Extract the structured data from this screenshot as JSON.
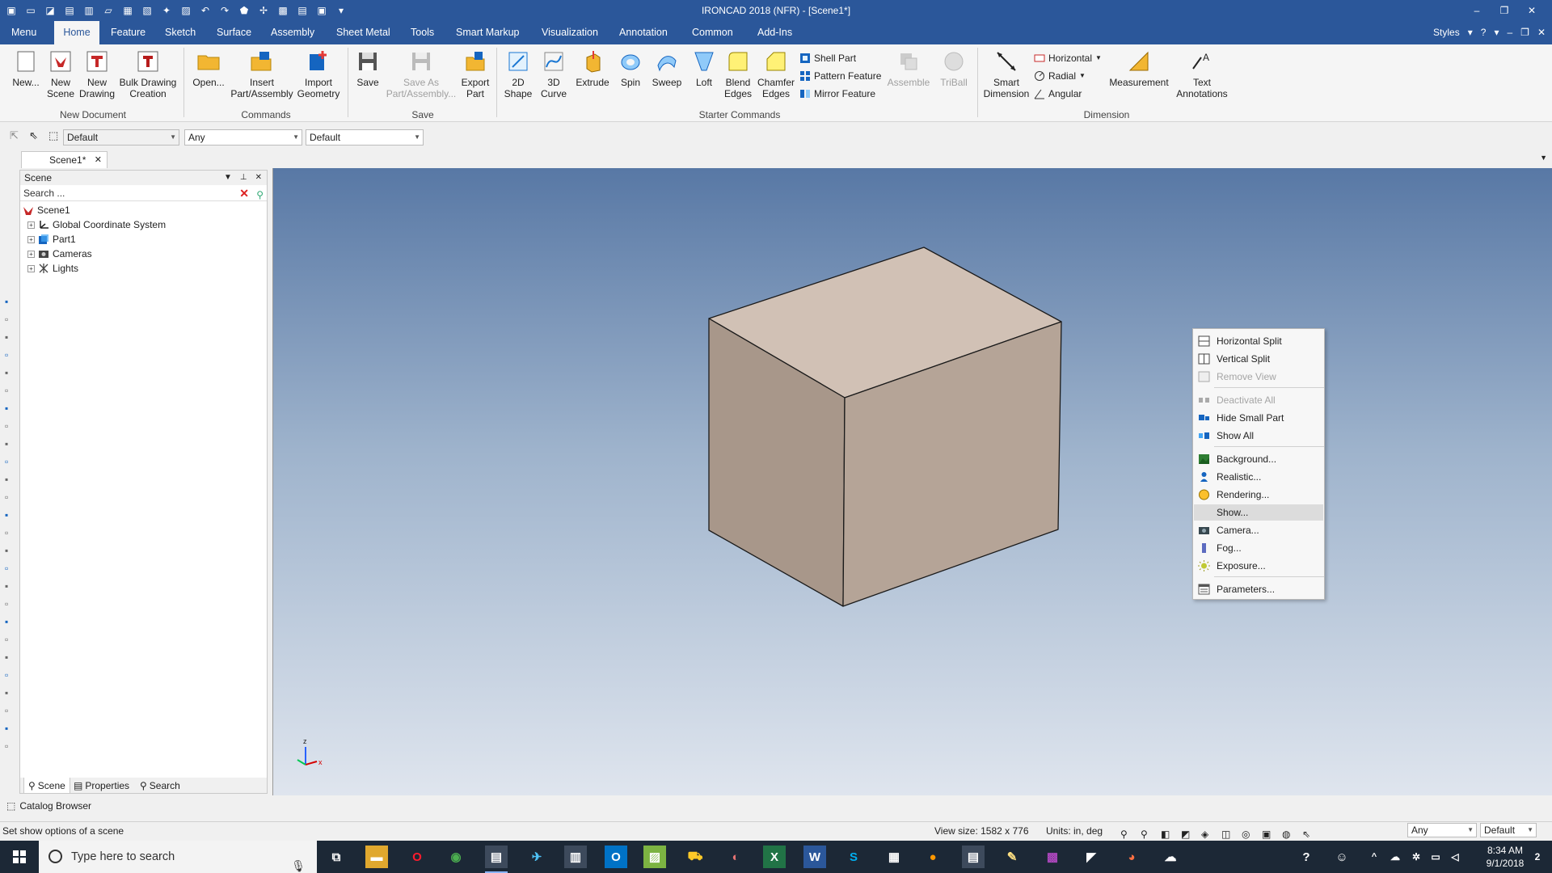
{
  "window": {
    "title": "IRONCAD 2018 (NFR) - [Scene1*]",
    "controls": [
      "–",
      "❐",
      "✕"
    ]
  },
  "ribbon_tabs": [
    {
      "label": "Menu"
    },
    {
      "label": "Home"
    },
    {
      "label": "Feature"
    },
    {
      "label": "Sketch"
    },
    {
      "label": "Surface"
    },
    {
      "label": "Assembly"
    },
    {
      "label": "Sheet Metal"
    },
    {
      "label": "Tools"
    },
    {
      "label": "Smart Markup"
    },
    {
      "label": "Visualization"
    },
    {
      "label": "Annotation"
    },
    {
      "label": "Common"
    },
    {
      "label": "Add-Ins"
    }
  ],
  "ribbon_right": {
    "styles": "Styles"
  },
  "ribbon": {
    "new_document": {
      "label": "New Document",
      "new": "New...",
      "new_scene_1": "New",
      "new_scene_2": "Scene",
      "new_drawing_1": "New",
      "new_drawing_2": "Drawing",
      "bulk_1": "Bulk Drawing",
      "bulk_2": "Creation"
    },
    "commands": {
      "label": "Commands",
      "open": "Open...",
      "insert_1": "Insert",
      "insert_2": "Part/Assembly",
      "import_1": "Import",
      "import_2": "Geometry"
    },
    "save": {
      "label": "Save",
      "save": "Save",
      "saveas_1": "Save As",
      "saveas_2": "Part/Assembly...",
      "export_1": "Export",
      "export_2": "Part"
    },
    "starter": {
      "label": "Starter Commands",
      "shape2d_1": "2D",
      "shape2d_2": "Shape",
      "curve3d_1": "3D",
      "curve3d_2": "Curve",
      "extrude": "Extrude",
      "spin": "Spin",
      "sweep": "Sweep",
      "loft": "Loft",
      "blend_1": "Blend",
      "blend_2": "Edges",
      "chamfer_1": "Chamfer",
      "chamfer_2": "Edges",
      "shell": "Shell Part",
      "pattern": "Pattern Feature",
      "mirror": "Mirror Feature",
      "assemble": "Assemble",
      "triball": "TriBall"
    },
    "dimension": {
      "label": "Dimension",
      "smart_1": "Smart",
      "smart_2": "Dimension",
      "horizontal": "Horizontal",
      "radial": "Radial",
      "angular": "Angular",
      "measurement": "Measurement",
      "text_1": "Text",
      "text_2": "Annotations"
    }
  },
  "toolbar": {
    "combo1": "Default",
    "combo2": "Any",
    "combo3": "Default"
  },
  "document_tab": {
    "label": "Scene1*"
  },
  "scene_panel": {
    "title": "Scene",
    "search_placeholder": "Search ...",
    "tree": [
      {
        "label": "Scene1"
      },
      {
        "label": "Global Coordinate System"
      },
      {
        "label": "Part1"
      },
      {
        "label": "Cameras"
      },
      {
        "label": "Lights"
      }
    ],
    "tabs": [
      {
        "label": "Scene"
      },
      {
        "label": "Properties"
      },
      {
        "label": "Search"
      }
    ]
  },
  "viewport": {
    "part_colors": {
      "top": "#d1c1b5",
      "left": "#a8978a",
      "front": "#b5a497",
      "edge": "#1a1a1a"
    },
    "triad": {
      "z": "z",
      "x": "x"
    }
  },
  "context_menu": {
    "items": [
      {
        "label": "Horizontal Split",
        "icon": "horizontal-split-icon",
        "disabled": false
      },
      {
        "label": "Vertical Split",
        "icon": "vertical-split-icon",
        "disabled": false
      },
      {
        "label": "Remove View",
        "icon": "remove-view-icon",
        "disabled": true
      },
      {
        "label": "Deactivate All",
        "icon": "deactivate-icon",
        "disabled": true
      },
      {
        "label": "Hide Small Part",
        "icon": "hide-small-part-icon",
        "disabled": false
      },
      {
        "label": "Show All",
        "icon": "show-all-icon",
        "disabled": false
      },
      {
        "label": "Background...",
        "icon": "background-icon",
        "disabled": false
      },
      {
        "label": "Realistic...",
        "icon": "realistic-icon",
        "disabled": false
      },
      {
        "label": "Rendering...",
        "icon": "rendering-icon",
        "disabled": false
      },
      {
        "label": "Show...",
        "icon": "show-icon",
        "disabled": false,
        "hover": true
      },
      {
        "label": "Camera...",
        "icon": "camera-icon",
        "disabled": false
      },
      {
        "label": "Fog...",
        "icon": "fog-icon",
        "disabled": false
      },
      {
        "label": "Exposure...",
        "icon": "exposure-icon",
        "disabled": false
      },
      {
        "label": "Parameters...",
        "icon": "parameters-icon",
        "disabled": false
      }
    ]
  },
  "catalog": {
    "label": "Catalog Browser"
  },
  "status": {
    "message": "Set show options of a scene",
    "view_size": "View size: 1582 x  776",
    "units": "Units: in, deg",
    "combo_any": "Any",
    "combo_default": "Default"
  },
  "taskbar": {
    "search_placeholder": "Type here to search",
    "time": "8:34 AM",
    "date": "9/1/2018",
    "notifications": "2"
  }
}
